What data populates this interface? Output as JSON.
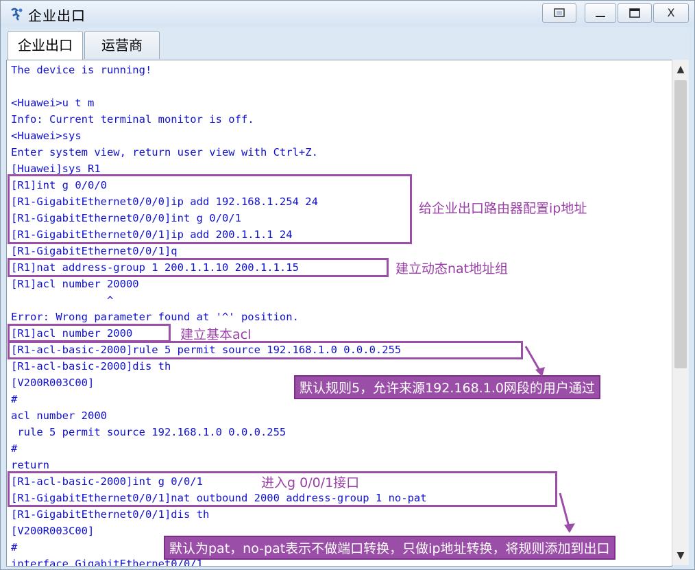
{
  "window": {
    "title": "企业出口",
    "buttons": {
      "restore": "restore-icon",
      "minimize": "—",
      "maximize": "maximize-icon",
      "close": "X"
    }
  },
  "tabs": [
    {
      "label": "企业出口",
      "active": true
    },
    {
      "label": "运营商",
      "active": false
    }
  ],
  "terminal": {
    "lines": [
      "The device is running!",
      "",
      "<Huawei>u t m",
      "Info: Current terminal monitor is off.",
      "<Huawei>sys",
      "Enter system view, return user view with Ctrl+Z.",
      "[Huawei]sys R1",
      "[R1]int g 0/0/0",
      "[R1-GigabitEthernet0/0/0]ip add 192.168.1.254 24",
      "[R1-GigabitEthernet0/0/0]int g 0/0/1",
      "[R1-GigabitEthernet0/0/1]ip add 200.1.1.1 24",
      "[R1-GigabitEthernet0/0/1]q",
      "[R1]nat address-group 1 200.1.1.10 200.1.1.15",
      "[R1]acl number 20000",
      "               ^",
      "Error: Wrong parameter found at '^' position.",
      "[R1]acl number 2000",
      "[R1-acl-basic-2000]rule 5 permit source 192.168.1.0 0.0.0.255",
      "[R1-acl-basic-2000]dis th",
      "[V200R003C00]",
      "#",
      "acl number 2000",
      " rule 5 permit source 192.168.1.0 0.0.0.255",
      "#",
      "return",
      "[R1-acl-basic-2000]int g 0/0/1",
      "[R1-GigabitEthernet0/0/1]nat outbound 2000 address-group 1 no-pat",
      "[R1-GigabitEthernet0/0/1]dis th",
      "[V200R003C00]",
      "#",
      "interface GigabitEthernet0/0/1"
    ]
  },
  "annotations": {
    "ip_config": "给企业出口路由器配置ip地址",
    "nat_group": "建立动态nat地址组",
    "basic_acl": "建立基本acl",
    "rule5": "默认规则5，允许来源192.168.1.0网段的用户通过",
    "enter_iface": "进入g 0/0/1接口",
    "pat_note": "默认为pat，no-pat表示不做端口转换，只做ip地址转换，将规则添加到出口"
  },
  "colors": {
    "terminal_text": "#1010d0",
    "annotation": "#9b4ea8"
  }
}
